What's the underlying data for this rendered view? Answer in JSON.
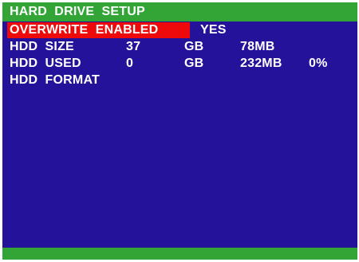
{
  "screen": {
    "title": "HARD  DRIVE  SETUP",
    "colors": {
      "background": "#25129a",
      "title_bar": "#33a537",
      "footer_bar": "#33a537",
      "highlight": "#ee0a0a",
      "text": "#ffffff"
    }
  },
  "menu": {
    "overwrite": {
      "label": "OVERWRITE  ENABLED",
      "value": "YES",
      "selected": true
    },
    "hdd_size": {
      "label": "HDD  SIZE",
      "amount": "37",
      "unit": "GB",
      "remaining": "78MB"
    },
    "hdd_used": {
      "label": "HDD  USED",
      "amount": "0",
      "unit": "GB",
      "used_mb": "232MB",
      "percent": "0%"
    },
    "hdd_format": {
      "label": "HDD  FORMAT"
    }
  }
}
